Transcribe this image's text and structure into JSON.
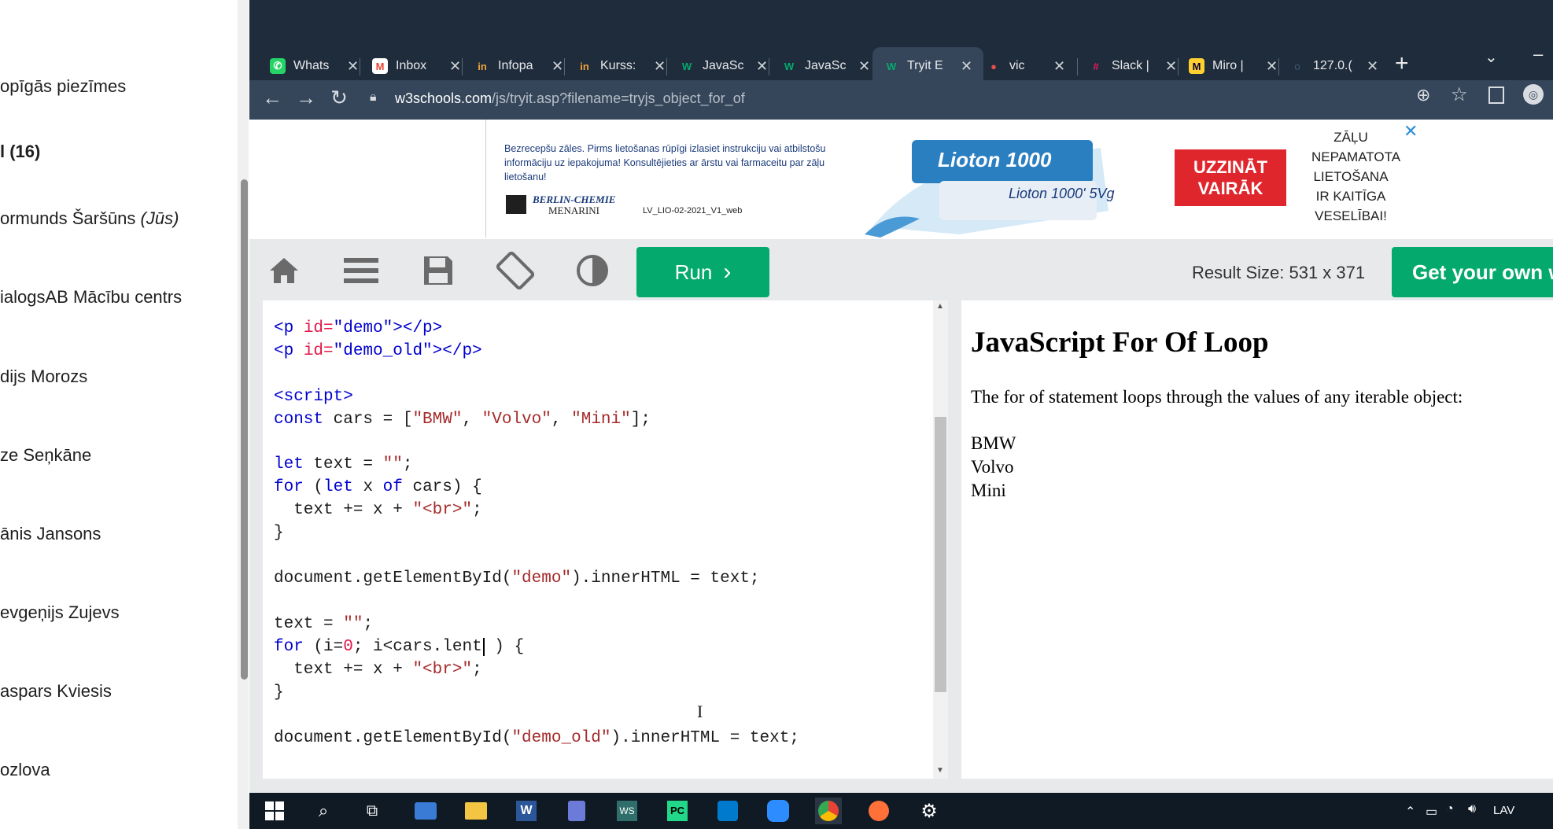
{
  "left_panel": {
    "items": [
      "opīgās piezīmes",
      "l (16)",
      "ormunds Šaršūns",
      "(Jūs)",
      "ialogsAB Mācību centrs",
      "dijs Morozs",
      "ze Seņkāne",
      "ānis Jansons",
      "evgeņijs Zujevs",
      "aspars Kviesis",
      "ozlova"
    ]
  },
  "browser": {
    "tabs": [
      {
        "label": "Whats",
        "icon": "whatsapp-icon",
        "color": "#25d366"
      },
      {
        "label": "Inbox",
        "icon": "gmail-icon",
        "color": "#ea4335"
      },
      {
        "label": "Infopa",
        "icon": "infopage-icon",
        "color": "#f0a23b"
      },
      {
        "label": "Kurss:",
        "icon": "infopage-icon",
        "color": "#f0a23b"
      },
      {
        "label": "JavaSc",
        "icon": "w3schools-icon",
        "color": "#04aa6d"
      },
      {
        "label": "JavaSc",
        "icon": "w3schools-icon",
        "color": "#04aa6d"
      },
      {
        "label": "Tryit E",
        "icon": "w3schools-icon",
        "color": "#04aa6d"
      },
      {
        "label": "vic",
        "icon": "video-icon",
        "color": "#e04e4e"
      },
      {
        "label": "Slack |",
        "icon": "slack-icon",
        "color": "#e01e5a"
      },
      {
        "label": "Miro |",
        "icon": "miro-icon",
        "color": "#ffd02f"
      },
      {
        "label": "127.0.(",
        "icon": "loading-icon",
        "color": "#8ab4f8"
      }
    ],
    "new_tab": "+",
    "url_host": "w3schools.com",
    "url_path": "/js/tryit.asp?filename=tryjs_object_for_of"
  },
  "ad": {
    "text": "Bezrecepšu zāles. Pirms lietošanas rūpīgi izlasiet instrukciju vai atbilstošu informāciju uz iepakojuma! Konsultējieties ar ārstu vai farmaceitu par zāļu lietošanu!",
    "brand_line1": "BERLIN-CHEMIE",
    "brand_line2": "MENARINI",
    "code": "LV_LIO-02-2021_V1_web",
    "product": "Lioton 1000",
    "product2": "Lioton 1000' 5Vg",
    "cta": "UZZINĀT VAIRĀK",
    "warning_lines": [
      "ZĀĻU",
      "NEPAMATOTA",
      "LIETOŠANA",
      "IR KAITĪGA",
      "VESELĪBAI!"
    ],
    "close": "✕"
  },
  "toolbar": {
    "run_label": "Run",
    "run_arrow": "›",
    "result_size": "Result Size: 531 x 371",
    "get_own": "Get your own w"
  },
  "editor": {
    "lines": [
      "<p id=\"demo\"></p>",
      "<p id=\"demo_old\"></p>",
      "",
      "<script>",
      "const cars = [\"BMW\", \"Volvo\", \"Mini\"];",
      "",
      "let text = \"\";",
      "for (let x of cars) {",
      "  text += x + \"<br>\";",
      "}",
      "",
      "document.getElementById(\"demo\").innerHTML = text;",
      "",
      "text = \"\";",
      "for (i=0; i<cars.lent ) {",
      "  text += x + \"<br>\";",
      "}",
      "",
      "document.getElementById(\"demo_old\").innerHTML = text;"
    ]
  },
  "result": {
    "heading": "JavaScript For Of Loop",
    "paragraph": "The for of statement loops through the values of any iterable object:",
    "items": [
      "BMW",
      "Volvo",
      "Mini"
    ]
  },
  "taskbar": {
    "lang": "LAV"
  }
}
